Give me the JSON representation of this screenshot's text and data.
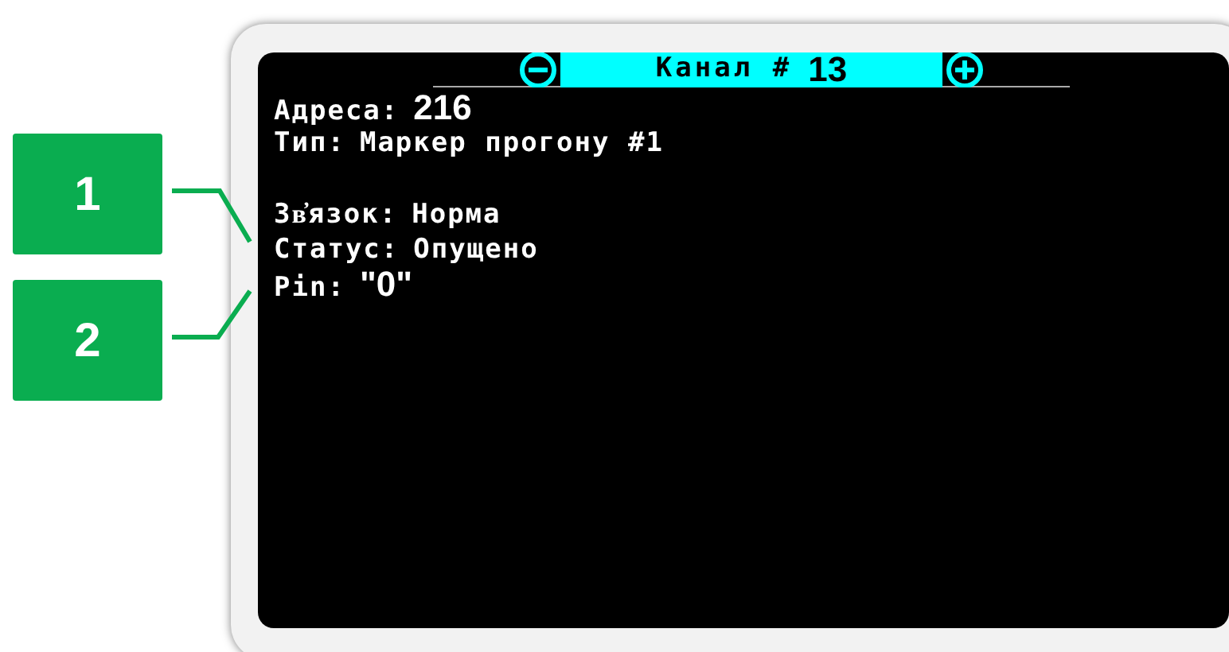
{
  "screen": {
    "header": {
      "title": "Канал #",
      "channel": "13"
    },
    "fields": [
      {
        "label": "Адреса:",
        "value": "216",
        "kind": "number"
      },
      {
        "label": "Тип:",
        "value": "Маркер прогону #1",
        "kind": "text"
      },
      {
        "kind": "gap"
      },
      {
        "label": "Зв҆язок:",
        "value": "Норма",
        "kind": "text"
      },
      {
        "label": "Статус:",
        "value": "Опущено",
        "kind": "text"
      },
      {
        "label": "Pin:",
        "value": "\"0\"",
        "kind": "number"
      }
    ]
  },
  "callouts": [
    {
      "label": "1"
    },
    {
      "label": "2"
    }
  ]
}
